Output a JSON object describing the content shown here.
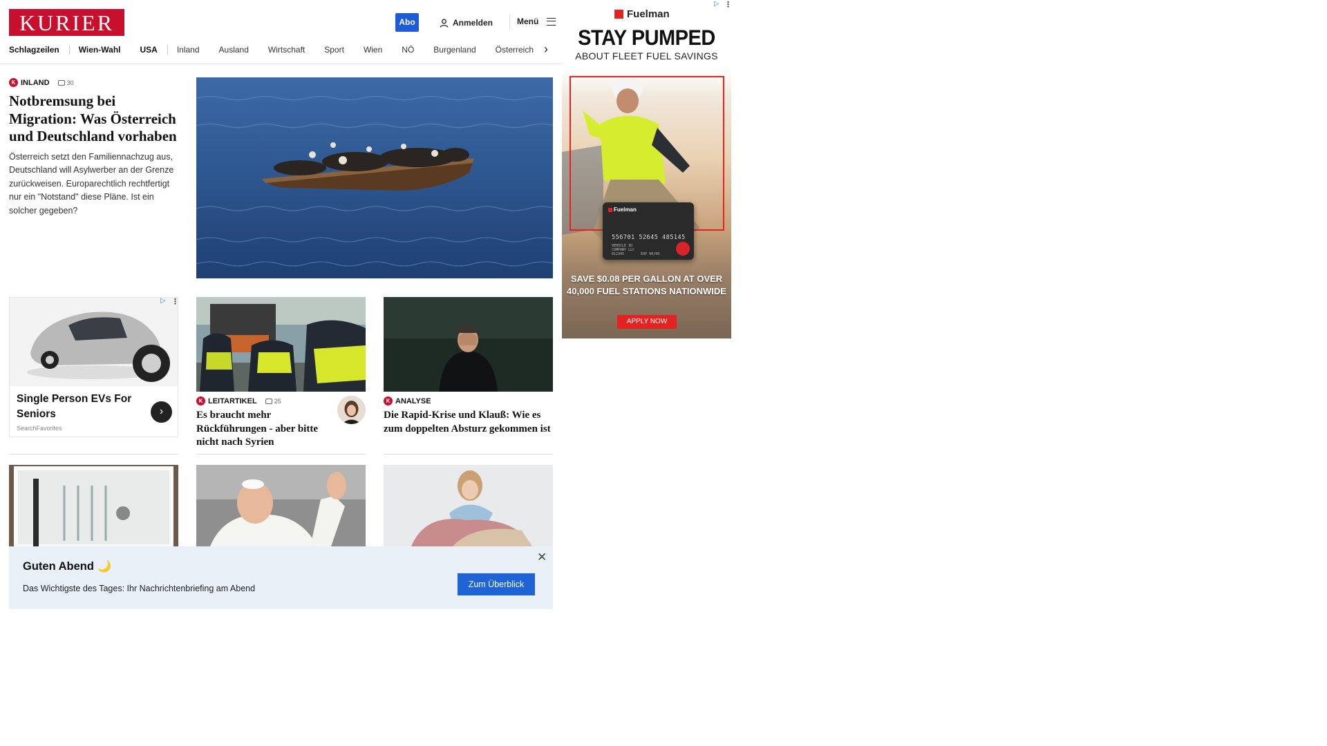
{
  "header": {
    "logo": "KURIER",
    "abo": "Abo",
    "login": "Anmelden",
    "menu": "Menü"
  },
  "nav": {
    "items": [
      "Schlagzeilen",
      "Wien-Wahl",
      "USA",
      "Inland",
      "Ausland",
      "Wirtschaft",
      "Sport",
      "Wien",
      "NÖ",
      "Burgenland",
      "Österreich"
    ]
  },
  "lead": {
    "kicker": "INLAND",
    "comments": "30",
    "title": "Notbremsung bei Migration: Was Österreich und Deutschland vorhaben",
    "teaser": "Österreich setzt den Familiennachzug aus, Deutschland will Asylwerber an der Grenze zurückweisen. Europarechtlich rechtfertigt nur ein \"Notstand\" diese Pläne. Ist ein solcher gegeben?"
  },
  "native_ad": {
    "title": "Single Person EVs For Seniors",
    "source": "SearchFavorites"
  },
  "cards": [
    {
      "kicker": "LEITARTIKEL",
      "comments": "25",
      "title": "Es braucht mehr Rückführungen - aber bitte nicht nach Syrien"
    },
    {
      "kicker": "ANALYSE",
      "comments": "",
      "title": "Die Rapid-Krise und Klauß: Wie es zum doppelten Absturz gekommen ist"
    }
  ],
  "side_ad": {
    "brand": "Fuelman",
    "headline": "STAY PUMPED",
    "subheadline": "ABOUT FLEET FUEL SAVINGS",
    "card_brand": "Fuelman",
    "card_number": "556701 52645 485145",
    "card_small": "VEHICLE ID\nCOMPANY LLC\n012345        EXP 00/00",
    "offer_line1": "SAVE $0.08 PER GALLON AT OVER",
    "offer_line2": "40,000 FUEL STATIONS NATIONWIDE",
    "cta": "APPLY NOW"
  },
  "briefing": {
    "title": "Guten Abend 🌙",
    "text": "Das Wichtigste des Tages: Ihr Nachrichtenbriefing am Abend",
    "button": "Zum Überblick"
  },
  "colors": {
    "brand_red": "#c8102e",
    "abo_blue": "#1e5bd8",
    "banner_bg": "#e9f0f8",
    "cta_blue": "#1e64d6",
    "ad_red": "#e32222"
  }
}
